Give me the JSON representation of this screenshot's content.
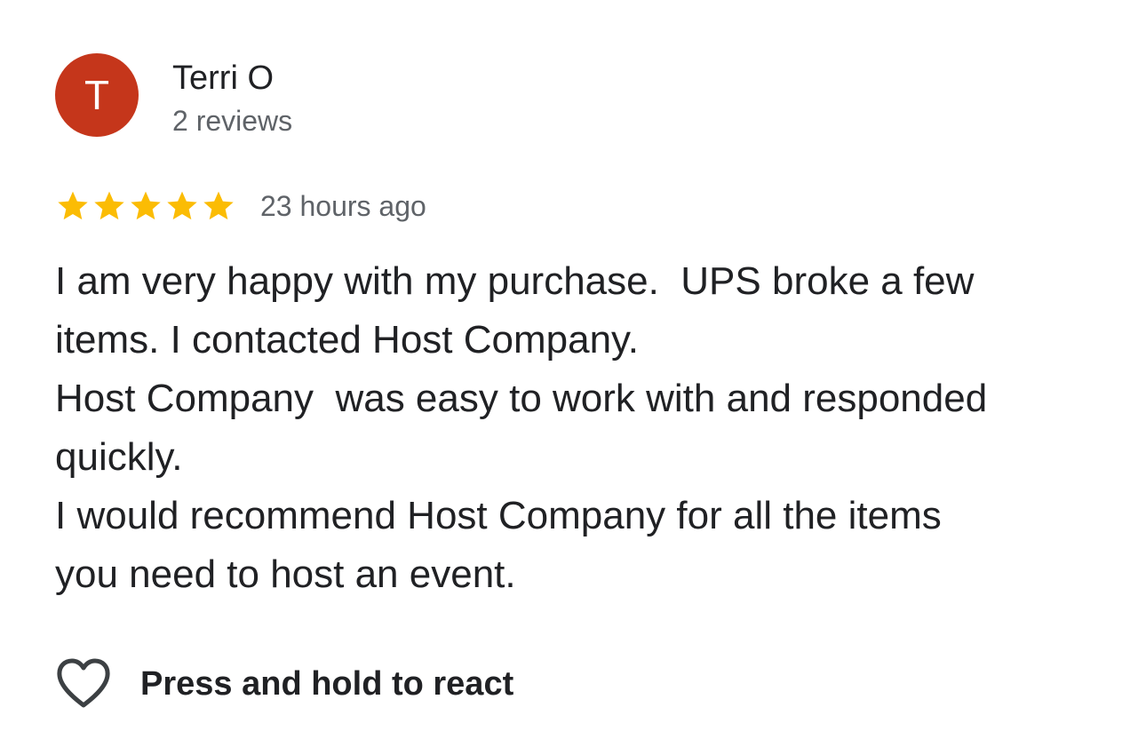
{
  "review": {
    "author": {
      "initial": "T",
      "name": "Terri O",
      "meta": "2 reviews",
      "avatar_color": "#c5361b"
    },
    "rating": {
      "stars": 5,
      "max_stars": 5,
      "star_icon": "star-icon",
      "star_color": "#fbbc04"
    },
    "time": "23 hours ago",
    "text": "I am very happy with my purchase.  UPS broke a few\nitems. I contacted Host Company.\nHost Company  was easy to work with and responded\nquickly.\nI would recommend Host Company for all the items\nyou need to host an event."
  },
  "reaction": {
    "icon": "heart-outline-icon",
    "label": "Press and hold to react"
  }
}
